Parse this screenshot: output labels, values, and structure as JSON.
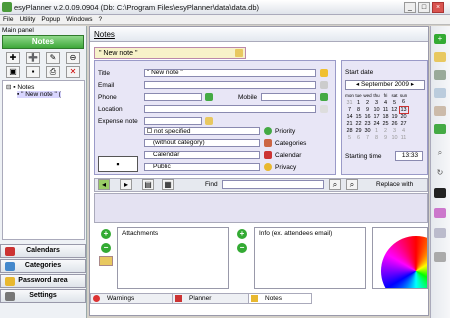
{
  "window": {
    "title": "esyPlanner v.2.0.09.0904 (Db: C:\\Program Files\\esyPlanner\\data\\data.db)"
  },
  "menu": [
    "File",
    "Utility",
    "Popup",
    "Windows",
    "?"
  ],
  "left": {
    "panel_label": "Main panel",
    "notes_button": "Notes",
    "tree_root": "Notes",
    "tree_item": "\" New note \" (",
    "nav": [
      "Calendars",
      "Categories",
      "Password area",
      "Settings"
    ]
  },
  "main": {
    "header": "Notes",
    "tab_label": "\" New note \"",
    "form": {
      "title_label": "Title",
      "title_value": "\" New note \"",
      "email_label": "Email",
      "phone_label": "Phone",
      "mobile_label": "Mobile",
      "location_label": "Location",
      "expense_label": "Expense note",
      "priority_value": "not specified",
      "category_value": "(without category)",
      "calendar_value": "Calendar",
      "privacy_value": "Public",
      "priority_label": "Priority",
      "categories_label": "Categories",
      "calendar_label": "Calendar",
      "privacy_label": "Privacy"
    },
    "calendar": {
      "start_date_label": "Start date",
      "month": "September 2009",
      "weekdays": [
        "mon",
        "tue",
        "wed",
        "thu",
        "fri",
        "sat",
        "sun"
      ],
      "weeks": [
        [
          "31",
          "1",
          "2",
          "3",
          "4",
          "5",
          "6"
        ],
        [
          "7",
          "8",
          "9",
          "10",
          "11",
          "12",
          "13"
        ],
        [
          "14",
          "15",
          "16",
          "17",
          "18",
          "19",
          "20"
        ],
        [
          "21",
          "22",
          "23",
          "24",
          "25",
          "26",
          "27"
        ],
        [
          "28",
          "29",
          "30",
          "1",
          "2",
          "3",
          "4"
        ],
        [
          "5",
          "6",
          "7",
          "8",
          "9",
          "10",
          "11"
        ]
      ],
      "selected_day": "13",
      "start_time_label": "Starting time",
      "start_time_value": "13:33"
    },
    "find": {
      "find_label": "Find",
      "replace_label": "Replace with"
    },
    "attachments_label": "Attachments",
    "info_label": "Info (ex. attendees email)",
    "status_tabs": [
      "Warnings",
      "Planner",
      "Notes"
    ]
  },
  "colors": {
    "accent": "#3fa83a",
    "form_bg": "#e8e6f6",
    "selected": "#d9d6ff"
  }
}
